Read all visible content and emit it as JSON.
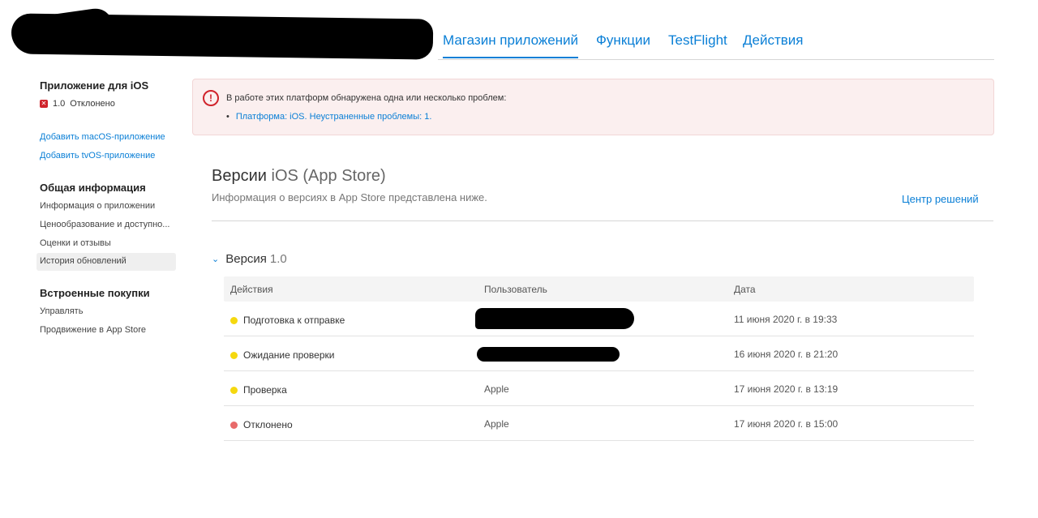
{
  "top_nav": {
    "tabs": [
      {
        "label": "Магазин приложений",
        "active": true
      },
      {
        "label": "Функции",
        "active": false
      },
      {
        "label": "TestFlight",
        "active": false
      },
      {
        "label": "Действия",
        "active": false
      }
    ]
  },
  "sidebar": {
    "app_heading": "Приложение для iOS",
    "app_status_version": "1.0",
    "app_status_text": "Отклонено",
    "add_links": [
      "Добавить macOS-приложение",
      "Добавить tvOS-приложение"
    ],
    "general_heading": "Общая информация",
    "general_items": [
      "Информация о приложении",
      "Ценообразование и доступно...",
      "Оценки и отзывы",
      "История обновлений"
    ],
    "purchases_heading": "Встроенные покупки",
    "purchases_items": [
      "Управлять",
      "Продвижение в App Store"
    ]
  },
  "alert": {
    "icon": "exclamation-circle-icon",
    "message": "В работе этих платформ обнаружена одна или несколько проблем:",
    "item": "Платформа: iOS. Неустраненные проблемы: 1."
  },
  "main": {
    "title_part1": "Версии",
    "title_part2": "iOS (App Store)",
    "subtitle": "Информация о версиях в App Store представлена ниже.",
    "center_link": "Центр решений",
    "version_label": "Версия",
    "version_number": "1.0"
  },
  "table": {
    "headers": [
      "Действия",
      "Пользователь",
      "Дата"
    ],
    "rows": [
      {
        "action": "Подготовка к отправке",
        "user": "",
        "date": "11 июня 2020 г. в 19:33",
        "color": "#f5d80f"
      },
      {
        "action": "Ожидание проверки",
        "user": "",
        "date": "16 июня 2020 г. в 21:20",
        "color": "#f5d80f"
      },
      {
        "action": "Проверка",
        "user": "Apple",
        "date": "17 июня 2020 г. в 13:19",
        "color": "#f5d80f"
      },
      {
        "action": "Отклонено",
        "user": "Apple",
        "date": "17 июня 2020 г. в 15:00",
        "color": "#e86a6a"
      }
    ]
  },
  "colors": {
    "accent": "#0a7fd6",
    "error": "#d0232b",
    "alert_bg": "#fbefef"
  }
}
